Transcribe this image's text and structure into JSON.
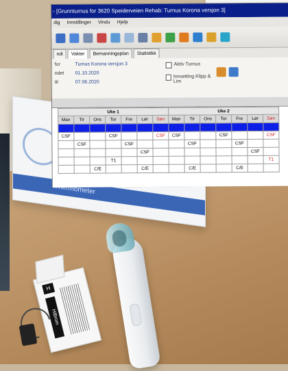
{
  "app": {
    "title": "- [Grunnturnus for 3620 Speiderveien Rehab: Turnus Korona versjon 3]",
    "menu": [
      "dig",
      "Innstillinger",
      "Vindu",
      "Hjelp"
    ],
    "tabs": [
      "ndi",
      "Vakter",
      "Bemanningsplan",
      "Statistikk"
    ],
    "props": {
      "navn_label": "for",
      "navn_value": "Turnus Korona versjon 3",
      "fra_label": "ndet",
      "fra_value": "01.10.2020",
      "til_label": "til",
      "til_value": "07.06.2020"
    },
    "checks": {
      "aktiv": "Aktiv Turnus",
      "innsetting": "Innsetting Klipp & Lim"
    }
  },
  "grid": {
    "week1": "Uke 1",
    "week2": "Uke 2",
    "days": [
      "Man",
      "Tir",
      "Ons",
      "Tor",
      "Fre",
      "Lør",
      "Søn"
    ],
    "rows": [
      [
        "CSF",
        "",
        "",
        "CSF",
        "",
        "",
        "CSF",
        "CSF",
        "",
        "",
        "CSF",
        "",
        "",
        "CSF"
      ],
      [
        "",
        "CSF",
        "",
        "",
        "CSF",
        "",
        "",
        "",
        "CSF",
        "",
        "",
        "CSF",
        "",
        ""
      ],
      [
        "",
        "",
        "",
        "",
        "",
        "CSF",
        "",
        "",
        "",
        "",
        "",
        "",
        "CSF",
        ""
      ],
      [
        "",
        "",
        "",
        "T1",
        "",
        "",
        "",
        "",
        "",
        "",
        "",
        "",
        "",
        "T1"
      ],
      [
        "",
        "",
        "C/E",
        "",
        "",
        "C/E",
        "",
        "",
        "C/E",
        "",
        "",
        "C/E",
        "",
        ""
      ]
    ]
  },
  "package": {
    "brand_mark": "H",
    "brand_name": "HiBrom"
  },
  "box": {
    "brand_line": "Thermometer"
  }
}
